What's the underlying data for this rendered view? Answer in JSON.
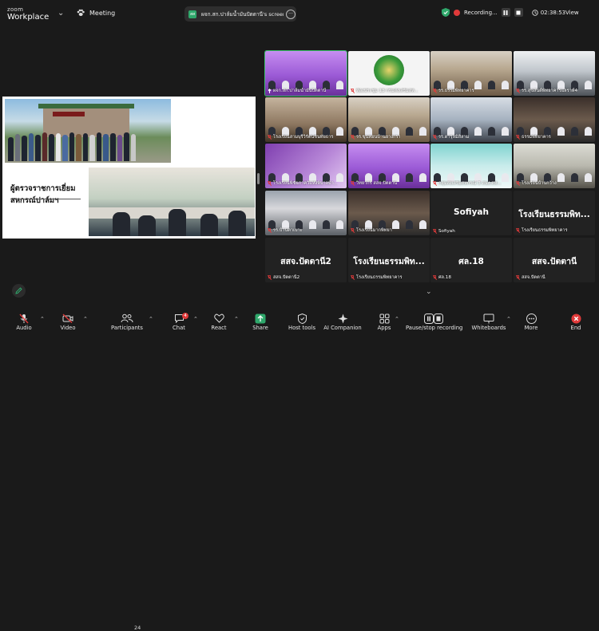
{
  "app": {
    "brand_top": "zoom",
    "brand_bottom": "Workplace",
    "meeting_label": "Meeting"
  },
  "share": {
    "avatar": "สส",
    "title": "ผจก.สก.ปาล์มน้ำมันปัตตานี's screen"
  },
  "recording": {
    "label": "Recording...",
    "timer": "02:38:53"
  },
  "view_label": "View",
  "slide": {
    "title_line1": "ผู้ตรวจราชการเยี่ยม",
    "title_line2": "สหกรณ์ปาล์มฯ"
  },
  "tiles": [
    {
      "name": "ผจก.สก.ปาล์มน้ำมันปัตตานี",
      "muted": false,
      "speaker": true
    },
    {
      "name": "ห้องประชุม 13 กรมส่งเสริมสห...",
      "muted": true
    },
    {
      "name": "รร.ธรรมพิทยาคาร",
      "muted": true
    },
    {
      "name": "รร.สุขสันต์พิทยาคารแลราห์4",
      "muted": true
    },
    {
      "name": "โรงเรียนสามบุรีวิรัตน์ชนทัยธาร",
      "muted": true
    },
    {
      "name": "รร.ขุนทอนบ้านยางกรา",
      "muted": true
    },
    {
      "name": "รร.ดารุลมิสิสาม",
      "muted": true
    },
    {
      "name": "ธรรมพิทยาคาร",
      "muted": true
    },
    {
      "name": "โรงเรียนพิชัยภาควิแห่งพิบาลบ้า...",
      "muted": true
    },
    {
      "name": "วิทยากร สสจ.ปัตตานี",
      "muted": true
    },
    {
      "name": "กลุ่มส่งเสริมสหกรณ์ 3 สนง.สห...",
      "muted": true
    },
    {
      "name": "โรงเรียนบ้านกว้าง",
      "muted": true
    },
    {
      "name": "รร.บ้านตาเบาะ",
      "muted": true
    },
    {
      "name": "โรงเรียนมากพิทยา",
      "muted": true
    },
    {
      "name": "Sofiyah",
      "big": "Sofiyah",
      "muted": true
    },
    {
      "name": "โรงเรียนธรรมพิทยาคาร",
      "big": "โรงเรียนธรรมพิท...",
      "muted": true
    },
    {
      "name": "สสจ.ปัตตานี2",
      "big": "สสจ.ปัตตานี2",
      "muted": true
    },
    {
      "name": "โรงเรียนธรรมพิทยาคาร",
      "big": "โรงเรียนธรรมพิท...",
      "muted": true
    },
    {
      "name": "ศล.18",
      "big": "ศล.18",
      "muted": true
    },
    {
      "name": "สสจ.ปัตตานี",
      "big": "สสจ.ปัตตานี",
      "muted": true
    }
  ],
  "toolbar": {
    "audio": "Audio",
    "video": "Video",
    "participants": "Participants",
    "participants_count": "24",
    "chat": "Chat",
    "chat_badge": "4",
    "react": "React",
    "share": "Share",
    "host_tools": "Host tools",
    "ai_companion": "AI Companion",
    "apps": "Apps",
    "pause_rec": "Pause/stop recording",
    "whiteboards": "Whiteboards",
    "more": "More",
    "end": "End"
  },
  "colors": {
    "share_green": "#2fa86b",
    "rec_red": "#e03a3a",
    "end_red": "#e03a3a",
    "speaker_outline": "#3ac26a"
  }
}
